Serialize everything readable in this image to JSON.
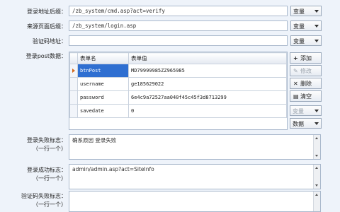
{
  "form": {
    "login_url_label": "登录地址后缀：",
    "login_url_value": "/zb_system/cmd.asp?act=verify",
    "source_page_label": "来源页面后缀：",
    "source_page_value": "/zb_system/login.asp",
    "captcha_url_label": "验证码地址：",
    "captcha_url_value": "",
    "post_data_label": "登录post数据：",
    "variable_option": "变量",
    "data_option": "数据",
    "fail_flag_label": "登录失败标志：",
    "fail_flag_sub": "（一行一个）",
    "fail_flag_value": "确系原因 登录失败",
    "success_flag_label": "登录成功标志：",
    "success_flag_sub": "（一行一个）",
    "success_flag_value": "admin/admin.asp?act=SiteInfo",
    "captcha_fail_label": "验证码失败标志：",
    "captcha_fail_sub": "（一行一个）"
  },
  "grid": {
    "headers": [
      "表单名",
      "表单值"
    ],
    "rows": [
      {
        "name": "btnPost",
        "value": "MD79999985ZZ965985"
      },
      {
        "name": "username",
        "value": "ge185629022"
      },
      {
        "name": "password",
        "value": "6e4c9a72527aa040f45c45f3d8713299"
      },
      {
        "name": "savedate",
        "value": "0"
      }
    ]
  },
  "side_buttons": {
    "add": "添加",
    "edit": "修改",
    "delete": "删除",
    "clear": "清空",
    "variable": "变量",
    "data": "数据"
  }
}
